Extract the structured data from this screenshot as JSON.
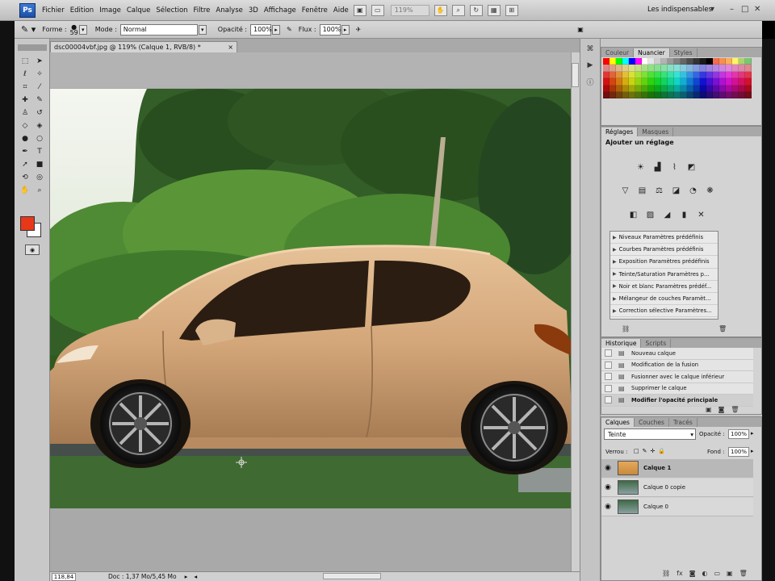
{
  "app": {
    "logo": "Ps",
    "menu": [
      "Fichier",
      "Edition",
      "Image",
      "Calque",
      "Sélection",
      "Filtre",
      "Analyse",
      "3D",
      "Affichage",
      "Fenêtre",
      "Aide"
    ],
    "zoom_display": "119%",
    "workspace": "Les indispensables",
    "window_controls": [
      "–",
      "□",
      "✕"
    ]
  },
  "options_bar": {
    "forme_label": "Forme :",
    "brush_size": "59",
    "mode_label": "Mode :",
    "mode_value": "Normal",
    "opacity_label": "Opacité :",
    "opacity_value": "100%",
    "flux_label": "Flux :",
    "flux_value": "100%"
  },
  "document": {
    "tab_title": "dsc00004vbf.jpg @ 119% (Calque 1, RVB/8) *",
    "close": "×",
    "status_zoom": "118,84",
    "status_doc": "Doc : 1,37 Mo/5,45 Mo"
  },
  "panels": {
    "color_tabs": [
      "Couleur",
      "Nuancier",
      "Styles"
    ],
    "adjust_tabs": [
      "Réglages",
      "Masques"
    ],
    "adjust_title": "Ajouter un réglage",
    "presets": [
      "Niveaux Paramètres prédéfinis",
      "Courbes Paramètres prédéfinis",
      "Exposition Paramètres prédéfinis",
      "Teinte/Saturation Paramètres p...",
      "Noir et blanc Paramètres prédéf...",
      "Mélangeur de couches Paramèt...",
      "Correction sélective Paramètres..."
    ],
    "history_tabs": [
      "Historique",
      "Scripts"
    ],
    "history": [
      {
        "label": "Nouveau calque",
        "current": false
      },
      {
        "label": "Modification de la fusion",
        "current": false
      },
      {
        "label": "Fusionner avec le calque inférieur",
        "current": false
      },
      {
        "label": "Supprimer le calque",
        "current": false
      },
      {
        "label": "Modifier l'opacité principale",
        "current": true
      }
    ],
    "layers_tabs": [
      "Calques",
      "Couches",
      "Tracés"
    ],
    "blend_mode": "Teinte",
    "layer_opacity_label": "Opacité :",
    "layer_opacity": "100%",
    "lock_label": "Verrou :",
    "fill_label": "Fond :",
    "fill_value": "100%",
    "layers": [
      {
        "name": "Calque 1",
        "selected": true
      },
      {
        "name": "Calque 0 copie",
        "selected": false
      },
      {
        "name": "Calque 0",
        "selected": false
      }
    ]
  },
  "colors": {
    "foreground": "#e8381a",
    "background": "#ffffff"
  },
  "icons": {
    "tools": [
      "marquee-icon",
      "move-icon",
      "lasso-icon",
      "magic-wand-icon",
      "crop-icon",
      "eyedropper-icon",
      "healing-icon",
      "brush-icon",
      "stamp-icon",
      "history-brush-icon",
      "eraser-icon",
      "paint-bucket-icon",
      "blur-icon",
      "dodge-icon",
      "pen-icon",
      "text-icon",
      "path-select-icon",
      "shape-icon",
      "3d-rotate-icon",
      "3d-orbit-icon",
      "hand-icon",
      "zoom-icon"
    ]
  }
}
